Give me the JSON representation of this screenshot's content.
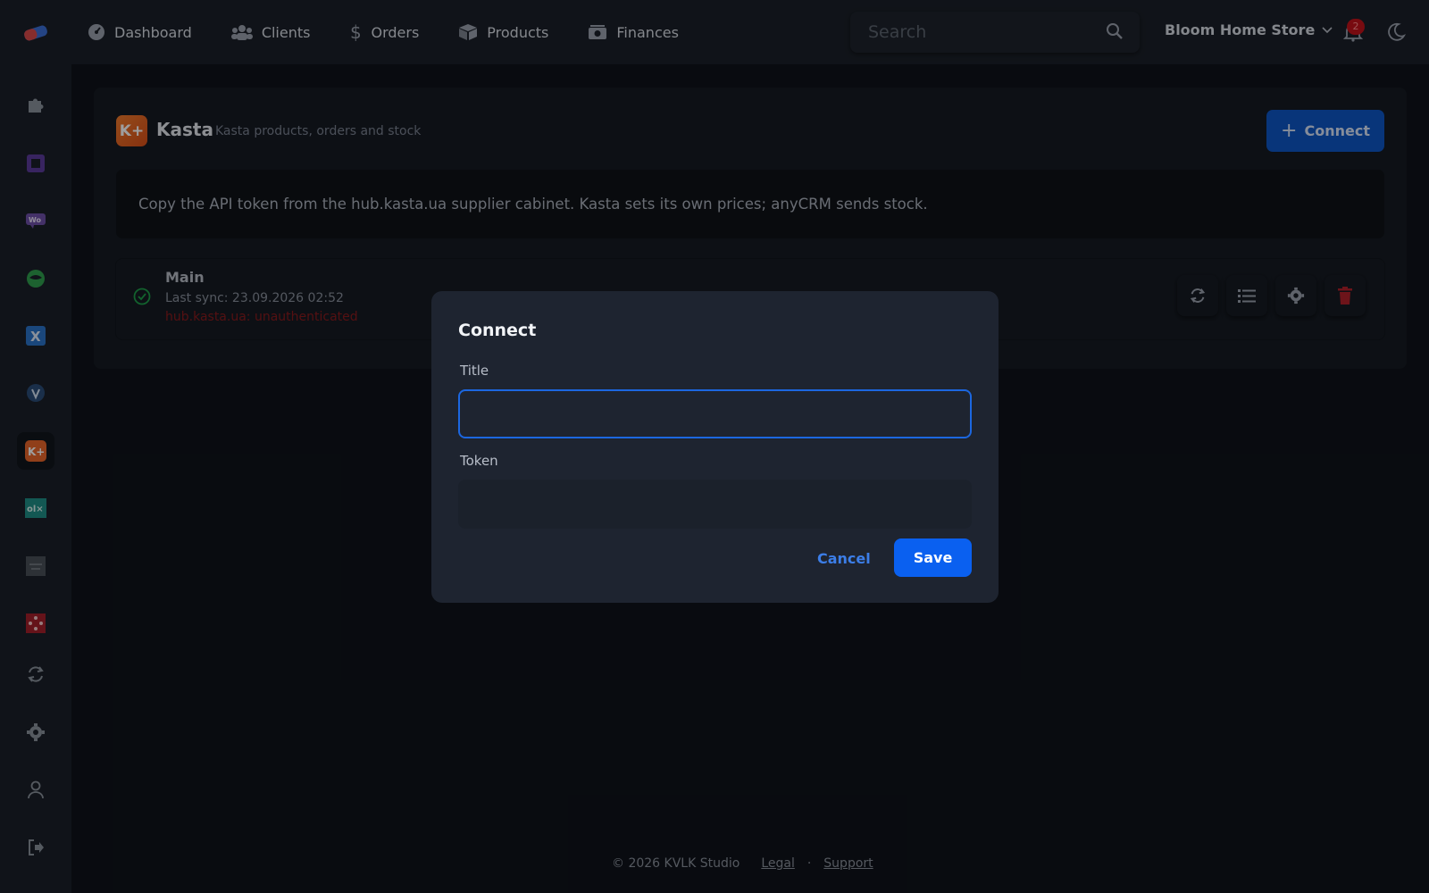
{
  "topbar": {
    "nav": [
      {
        "label": "Dashboard",
        "icon": "dashboard-gauge-icon"
      },
      {
        "label": "Clients",
        "icon": "users-icon"
      },
      {
        "label": "Orders",
        "icon": "dollar-icon"
      },
      {
        "label": "Products",
        "icon": "box-icon"
      },
      {
        "label": "Finances",
        "icon": "money-icon"
      }
    ],
    "search": {
      "placeholder": "Search",
      "value": ""
    },
    "store_name": "Bloom Home Store",
    "notification_count": "2"
  },
  "sidebar": {
    "items": [
      {
        "icon": "puzzle-icon"
      },
      {
        "icon": "square-app-icon"
      },
      {
        "icon": "woo-icon"
      },
      {
        "icon": "green-leaf-icon"
      },
      {
        "icon": "x-app-icon"
      },
      {
        "icon": "shield-app-icon"
      },
      {
        "icon": "kasta-icon",
        "active": true
      },
      {
        "icon": "olx-icon"
      },
      {
        "icon": "store-app-icon"
      },
      {
        "icon": "network-app-icon"
      },
      {
        "icon": "sync-icon"
      },
      {
        "icon": "gear-icon"
      },
      {
        "icon": "user-icon"
      },
      {
        "icon": "logout-icon"
      }
    ]
  },
  "integration": {
    "logo_text": "K+",
    "title": "Kasta",
    "subtitle": "Kasta products, orders and stock",
    "connect_label": "Connect",
    "info": "Copy the API token from the hub.kasta.ua supplier cabinet. Kasta sets its own prices; anyCRM sends stock.",
    "connection": {
      "name": "Main",
      "last_sync": "Last sync: 23.09.2026 02:52",
      "error": "hub.kasta.ua: unauthenticated"
    }
  },
  "modal": {
    "title": "Connect",
    "title_label": "Title",
    "title_value": "",
    "token_label": "Token",
    "token_value": "",
    "cancel_label": "Cancel",
    "save_label": "Save"
  },
  "footer": {
    "copyright": "© 2026 KVLK Studio",
    "legal": "Legal",
    "separator": "·",
    "support": "Support"
  },
  "colors": {
    "accent": "#0a60f0",
    "kasta": "#e8672a",
    "error": "#8a1a1e",
    "success": "#1e9e4a"
  }
}
